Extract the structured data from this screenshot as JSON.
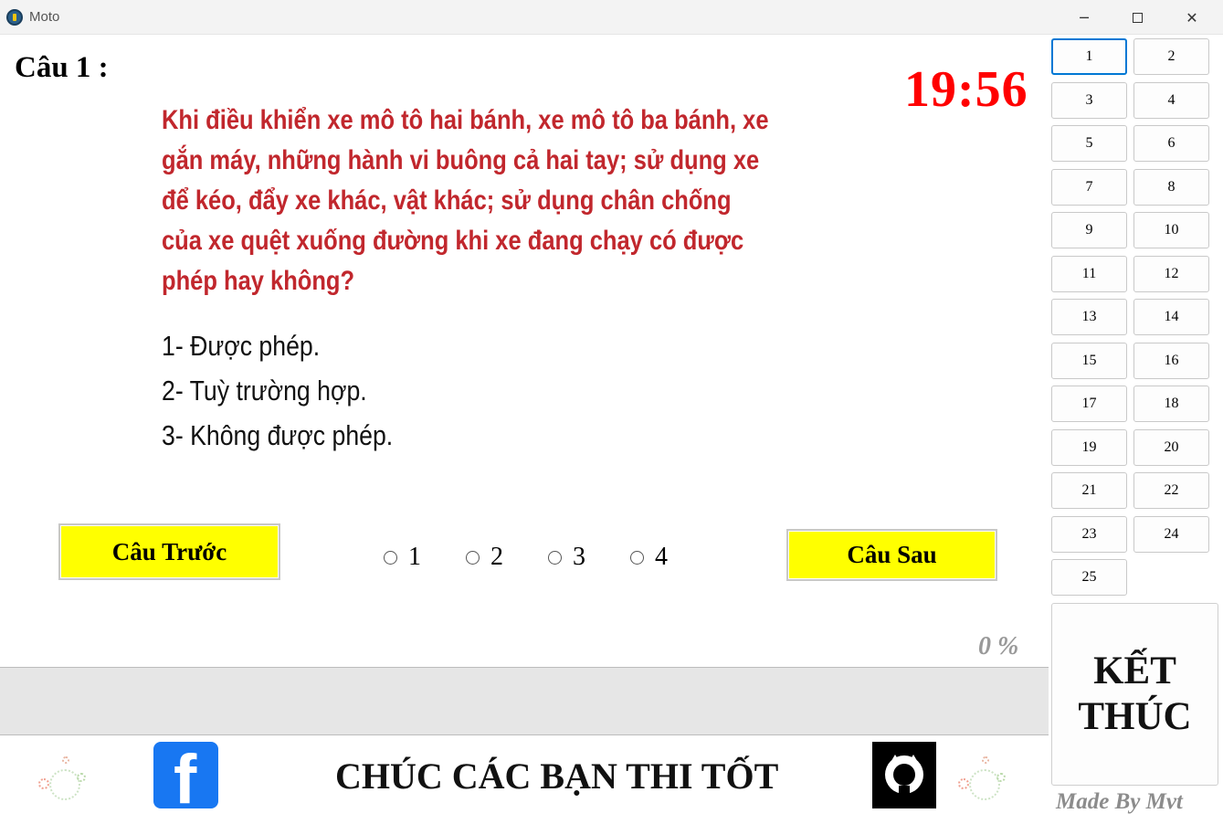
{
  "window": {
    "title": "Moto",
    "minimize_glyph": "─",
    "close_glyph": "✕"
  },
  "question": {
    "number_label": "Câu 1 :",
    "text": "Khi điều khiển xe mô tô hai bánh, xe mô tô ba bánh, xe gắn máy, những hành vi buông cả hai tay; sử dụng xe để kéo, đẩy xe khác, vật khác; sử dụng chân chống của xe quệt xuống đường khi xe đang chạy có được phép hay không?",
    "answers": [
      "1- Được phép.",
      "2- Tuỳ trường hợp.",
      "3- Không được phép."
    ]
  },
  "timer": "19:56",
  "nav": {
    "prev_label": "Câu Trước",
    "next_label": "Câu Sau"
  },
  "options": [
    "1",
    "2",
    "3",
    "4"
  ],
  "progress": {
    "percent_label": "0 %",
    "value": 0
  },
  "footer": {
    "message": "CHÚC CÁC BẠN THI TỐT",
    "facebook_letter": "f"
  },
  "question_buttons": [
    "1",
    "2",
    "3",
    "4",
    "5",
    "6",
    "7",
    "8",
    "9",
    "10",
    "11",
    "12",
    "13",
    "14",
    "15",
    "16",
    "17",
    "18",
    "19",
    "20",
    "21",
    "22",
    "23",
    "24",
    "25"
  ],
  "end_button": {
    "line1": "KẾT",
    "line2": "THÚC"
  },
  "credit": "Made By Mvt",
  "colors": {
    "question_text": "#c1272d",
    "timer": "#ff0000",
    "nav_button": "#ffff00",
    "facebook": "#1877f2",
    "active_border": "#0078d4"
  },
  "icons": [
    "app-icon",
    "facebook-icon",
    "github-icon",
    "fireworks-icon"
  ]
}
